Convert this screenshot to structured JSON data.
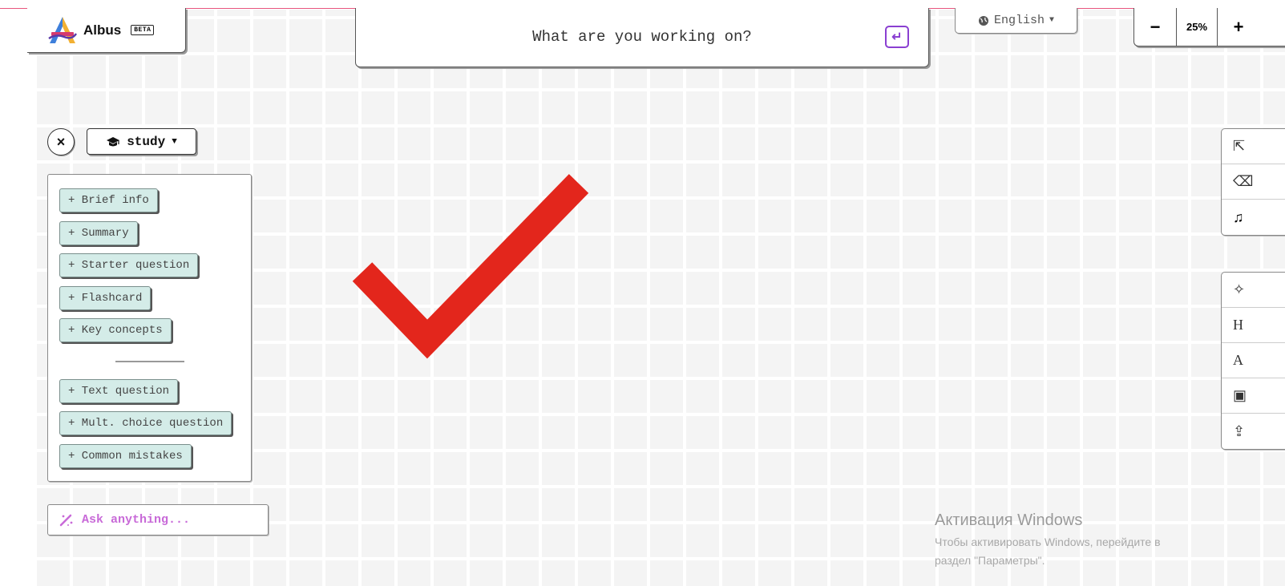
{
  "app": {
    "name": "Albus",
    "badge": "BETA"
  },
  "prompt": {
    "placeholder": "What are you working on?",
    "enter_icon": "↵"
  },
  "language": {
    "globe_icon": "globe-icon",
    "selected": "English",
    "caret": "▼"
  },
  "zoom": {
    "minus": "−",
    "level": "25%",
    "plus": "+"
  },
  "mode": {
    "close": "×",
    "icon": "graduation-cap-icon",
    "label": "study",
    "caret": "▼"
  },
  "panel": {
    "items": [
      "+ Brief info",
      "+ Summary",
      "+ Starter question",
      "+ Flashcard",
      "+ Key concepts"
    ],
    "items_after_divider": [
      "+ Text question",
      "+ Mult. choice question",
      "+ Common mistakes"
    ]
  },
  "ask": {
    "placeholder": "Ask anything..."
  },
  "toolbar_top": [
    {
      "icon": "share-icon",
      "glyph": "⇱"
    },
    {
      "icon": "eraser-icon",
      "glyph": "⌫"
    },
    {
      "icon": "music-note-icon",
      "glyph": "♫"
    }
  ],
  "toolbar_bottom": [
    {
      "icon": "magic-wand-icon",
      "glyph": "✧"
    },
    {
      "icon": "heading-icon",
      "glyph": "H"
    },
    {
      "icon": "text-icon",
      "glyph": "A"
    },
    {
      "icon": "image-icon",
      "glyph": "▣"
    },
    {
      "icon": "upload-icon",
      "glyph": "⇪"
    }
  ],
  "windows_watermark": {
    "title": "Активация Windows",
    "line1": "Чтобы активировать Windows, перейдите в",
    "line2": "раздел \"Параметры\"."
  },
  "colors": {
    "accent_purple": "#8a3fd1",
    "chip_bg": "#d4ece8",
    "checkmark_red": "#e3261c",
    "top_line": "#e8557e"
  }
}
